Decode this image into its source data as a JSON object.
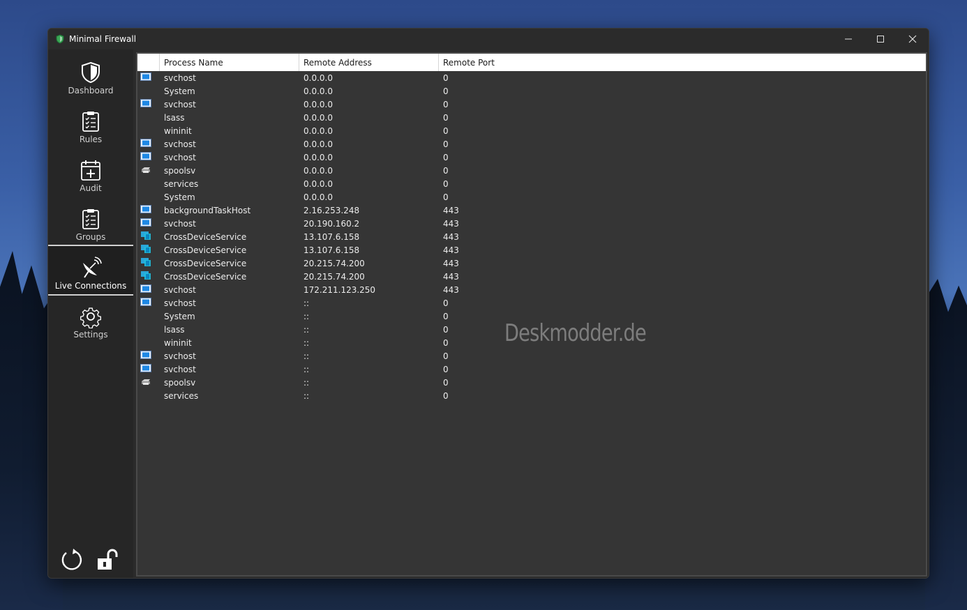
{
  "window": {
    "title": "Minimal Firewall",
    "controls": [
      "minimize-icon",
      "maximize-icon",
      "close-icon"
    ]
  },
  "sidebar": {
    "items": [
      {
        "label": "Dashboard",
        "icon": "shield-icon",
        "active": false
      },
      {
        "label": "Rules",
        "icon": "clipboard-list-icon",
        "active": false
      },
      {
        "label": "Audit",
        "icon": "calendar-plus-icon",
        "active": false
      },
      {
        "label": "Groups",
        "icon": "clipboard-list-icon",
        "active": false
      },
      {
        "label": "Live Connections",
        "icon": "satellite-dish-icon",
        "active": true
      },
      {
        "label": "Settings",
        "icon": "gear-icon",
        "active": false
      }
    ],
    "bottom": [
      "refresh-icon",
      "unlock-icon"
    ]
  },
  "table": {
    "headers": [
      "Process Name",
      "Remote Address",
      "Remote Port"
    ],
    "rows": [
      {
        "icon": "window-app-icon",
        "name": "svchost",
        "address": "0.0.0.0",
        "port": "0"
      },
      {
        "icon": "",
        "name": "System",
        "address": "0.0.0.0",
        "port": "0"
      },
      {
        "icon": "window-app-icon",
        "name": "svchost",
        "address": "0.0.0.0",
        "port": "0"
      },
      {
        "icon": "",
        "name": "lsass",
        "address": "0.0.0.0",
        "port": "0"
      },
      {
        "icon": "",
        "name": "wininit",
        "address": "0.0.0.0",
        "port": "0"
      },
      {
        "icon": "window-app-icon",
        "name": "svchost",
        "address": "0.0.0.0",
        "port": "0"
      },
      {
        "icon": "window-app-icon",
        "name": "svchost",
        "address": "0.0.0.0",
        "port": "0"
      },
      {
        "icon": "printer-icon",
        "name": "spoolsv",
        "address": "0.0.0.0",
        "port": "0"
      },
      {
        "icon": "",
        "name": "services",
        "address": "0.0.0.0",
        "port": "0"
      },
      {
        "icon": "",
        "name": "System",
        "address": "0.0.0.0",
        "port": "0"
      },
      {
        "icon": "window-app-icon",
        "name": "backgroundTaskHost",
        "address": "2.16.253.248",
        "port": "443"
      },
      {
        "icon": "window-app-icon",
        "name": "svchost",
        "address": "20.190.160.2",
        "port": "443"
      },
      {
        "icon": "devices-icon",
        "name": "CrossDeviceService",
        "address": "13.107.6.158",
        "port": "443"
      },
      {
        "icon": "devices-icon",
        "name": "CrossDeviceService",
        "address": "13.107.6.158",
        "port": "443"
      },
      {
        "icon": "devices-icon",
        "name": "CrossDeviceService",
        "address": "20.215.74.200",
        "port": "443"
      },
      {
        "icon": "devices-icon",
        "name": "CrossDeviceService",
        "address": "20.215.74.200",
        "port": "443"
      },
      {
        "icon": "window-app-icon",
        "name": "svchost",
        "address": "172.211.123.250",
        "port": "443"
      },
      {
        "icon": "window-app-icon",
        "name": "svchost",
        "address": "::",
        "port": "0"
      },
      {
        "icon": "",
        "name": "System",
        "address": "::",
        "port": "0"
      },
      {
        "icon": "",
        "name": "lsass",
        "address": "::",
        "port": "0"
      },
      {
        "icon": "",
        "name": "wininit",
        "address": "::",
        "port": "0"
      },
      {
        "icon": "window-app-icon",
        "name": "svchost",
        "address": "::",
        "port": "0"
      },
      {
        "icon": "window-app-icon",
        "name": "svchost",
        "address": "::",
        "port": "0"
      },
      {
        "icon": "printer-icon",
        "name": "spoolsv",
        "address": "::",
        "port": "0"
      },
      {
        "icon": "",
        "name": "services",
        "address": "::",
        "port": "0"
      }
    ]
  },
  "watermark": "Deskmodder.de",
  "colors": {
    "window_bg": "#2b2b2b",
    "sidebar_bg": "#262626",
    "content_bg": "#353535",
    "header_bg": "#ffffff",
    "shield_green": "#3aa655",
    "app_icon_blue": "#1e88e5"
  }
}
